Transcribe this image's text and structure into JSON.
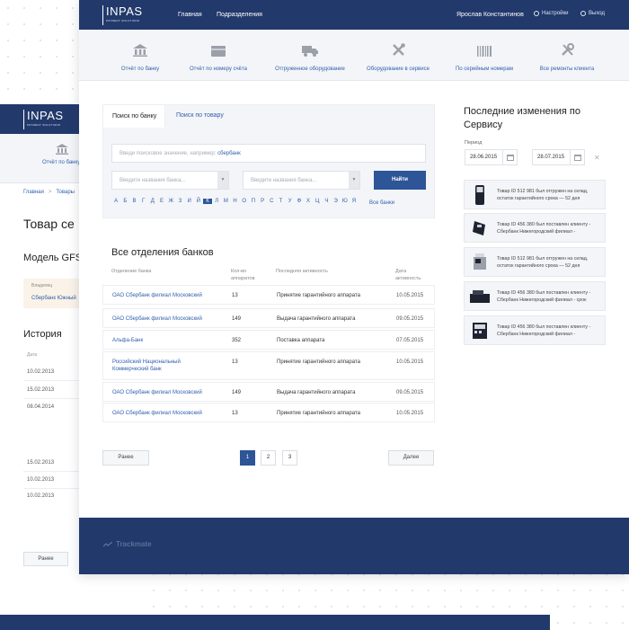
{
  "brand": {
    "name": "INPAS",
    "tagline": "PAYMENT SOLUTIONS"
  },
  "topnav": {
    "links": [
      "Главная",
      "Подразделения"
    ],
    "user": "Ярослав Константинов",
    "settings": "Настройки",
    "logout": "Выход"
  },
  "subnav": [
    {
      "label": "Отчёт по банку",
      "icon": "bank-icon"
    },
    {
      "label": "Отчёт по номеру счёта",
      "icon": "card-icon"
    },
    {
      "label": "Отгруженное оборудование",
      "icon": "truck-icon"
    },
    {
      "label": "Оборудование в сервисе",
      "icon": "tools-icon"
    },
    {
      "label": "По серийным номерам",
      "icon": "barcode-icon"
    },
    {
      "label": "Все ремонты клиента",
      "icon": "wrench-icon"
    }
  ],
  "search": {
    "tab_active": "Поиск по банку",
    "tab_inactive": "Поиск по товару",
    "placeholder": "Введи поисковое значение, например:",
    "placeholder_hint": "сбербанк",
    "select1": "Введите названия банка...",
    "select2": "Введите названия банка...",
    "find": "Найти",
    "alphabet": [
      "А",
      "Б",
      "В",
      "Г",
      "Д",
      "Е",
      "Ж",
      "З",
      "И",
      "Й",
      "К",
      "Л",
      "М",
      "Н",
      "О",
      "П",
      "Р",
      "С",
      "Т",
      "У",
      "Ф",
      "Х",
      "Ц",
      "Ч",
      "Э",
      "Ю",
      "Я"
    ],
    "selected_letter": "К",
    "all_banks": "Все банки"
  },
  "table": {
    "title": "Все отделения банков",
    "headers": [
      "Отделение банка",
      "Кол-во аппаратов",
      "Последняя активность",
      "Дата активность"
    ],
    "rows": [
      {
        "bank": "ОАО Сбербанк филиал Московский",
        "count": "13",
        "activity": "Принятие гарантийного аппарата",
        "date": "10.05.2015"
      },
      {
        "bank": "ОАО Сбербанк филиал Московский",
        "count": "149",
        "activity": "Выдача гарантийного аппарата",
        "date": "09.05.2015"
      },
      {
        "bank": "Альфа-Банк",
        "count": "352",
        "activity": "Поставка аппарата",
        "date": "07.05.2015"
      },
      {
        "bank": "Российский Национальный Коммерческий банк",
        "count": "13",
        "activity": "Принятие гарантийного аппарата",
        "date": "10.05.2015"
      },
      {
        "bank": "ОАО Сбербанк филиал Московский",
        "count": "149",
        "activity": "Выдача гарантийного аппарата",
        "date": "09.05.2015"
      },
      {
        "bank": "ОАО Сбербанк филиал Московский",
        "count": "13",
        "activity": "Принятие гарантийного аппарата",
        "date": "10.05.2015"
      }
    ]
  },
  "pager": {
    "prev": "Ранее",
    "next": "Далее",
    "pages": [
      "1",
      "2",
      "3"
    ],
    "current": "1"
  },
  "changes": {
    "title": "Последние изменения по Сервису",
    "period_label": "Период",
    "date_from": "28.06.2015",
    "date_to": "28.07.2015",
    "items": [
      "Товар ID 512 981 был отгружен на склад, остаток гарантийного срока — 52 дня",
      "Товар ID 456 380 был поставлен клиенту - Сбербанк Нижегородский филиал -",
      "Товар ID 512 981 был отгружен на склад, остаток гарантийного срока — 52 дня",
      "Товар ID 456 380 был поставлен клиенту - Сбербанк Нижегородский филиал - срок",
      "Товар ID 456 380 был поставлен клиенту - Сбербанк Нижегородский филиал -"
    ]
  },
  "footer": {
    "brand": "Trackmate"
  },
  "background_window": {
    "sub_label": "Отчёт по банку",
    "crumbs": [
      "Главная",
      "Товары"
    ],
    "title": "Товар се",
    "model": "Модель GFS",
    "owner_label": "Владелец",
    "owner_value": "Сбербанк Южный",
    "history": "История",
    "date_header": "Дата",
    "dates": [
      "10.02.2013",
      "15.02.2013",
      "08.04.2014",
      "15.02.2013",
      "10.02.2013",
      "10.02.2013"
    ],
    "back": "Ранее"
  },
  "colors": {
    "navy": "#22396b",
    "accent": "#2d5597",
    "link": "#2f5fae"
  }
}
